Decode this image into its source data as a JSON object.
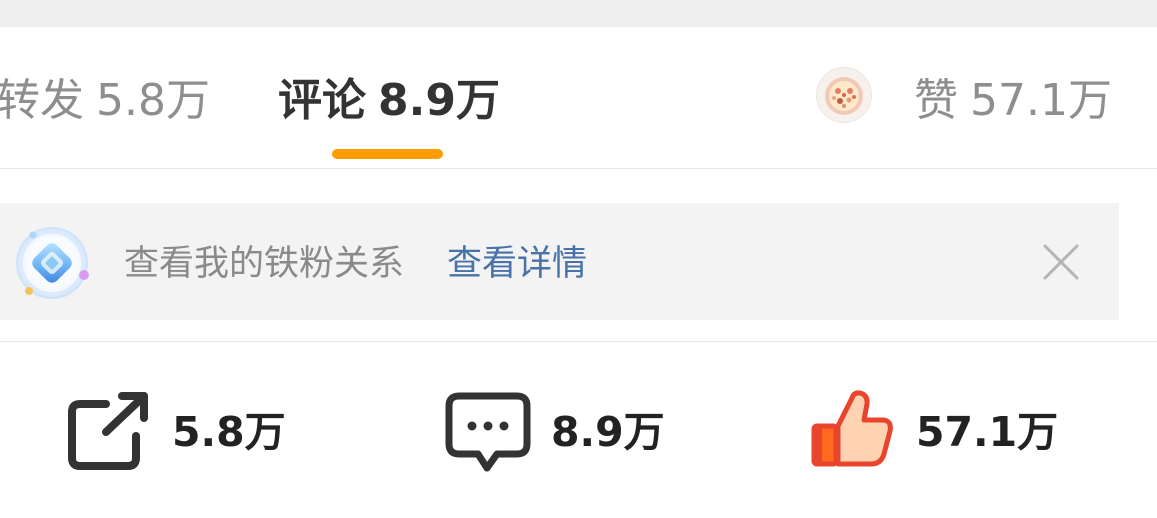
{
  "tabs": {
    "repost": {
      "label": "转发",
      "count": "5.8万"
    },
    "comment": {
      "label": "评论",
      "count": "8.9万"
    },
    "like": {
      "label": "赞",
      "count": "57.1万"
    },
    "active": "comment",
    "indicator_color": "#ff9d00"
  },
  "fan_banner": {
    "text": "查看我的铁粉关系",
    "link": "查看详情",
    "link_color": "#4872a8",
    "icon": "fan-badge-icon",
    "close_icon": "close-icon"
  },
  "action_bar": {
    "repost": {
      "icon": "share-icon",
      "count": "5.8万"
    },
    "comment": {
      "icon": "comment-bubble-icon",
      "count": "8.9万"
    },
    "like": {
      "icon": "thumbs-up-icon",
      "count": "57.1万",
      "color": "#e8442e"
    }
  }
}
